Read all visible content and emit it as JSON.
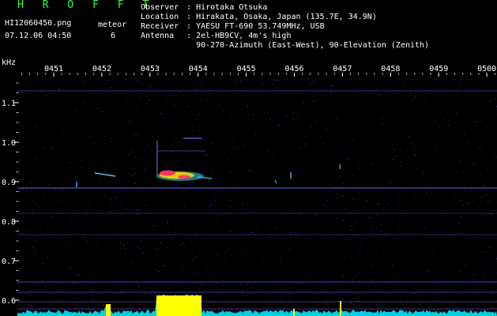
{
  "header": {
    "title": "H R O F F T",
    "file_name": "HI12060450.png",
    "meteor_label": "meteor",
    "timestamp": "07.12.06 04:50",
    "meteor_count": "6"
  },
  "info": [
    {
      "label": "Observer",
      "sep": ":",
      "value": "Hirotaka Otsuka"
    },
    {
      "label": "Location",
      "sep": ":",
      "value": "Hirakata, Osaka, Japan (135.7E, 34.9N)"
    },
    {
      "label": "Receiver",
      "sep": ":",
      "value": "YAESU FT-690 53.749MHz, USB"
    },
    {
      "label": "Antenna",
      "sep": ":",
      "value": "2el-HB9CV, 4m's high"
    },
    {
      "label": "",
      "sep": " ",
      "value": "90-270-Azimuth (East-West), 90-Elevation (Zenith)"
    }
  ],
  "axis": {
    "y_unit": "kHz",
    "time_ticks": [
      "0451",
      "0452",
      "0453",
      "0454",
      "0455",
      "0456",
      "0457",
      "0458",
      "0459",
      "0500"
    ],
    "freq_ticks": [
      "1.1",
      "1.0",
      "0.9",
      "0.8",
      "0.7",
      "0.6"
    ]
  },
  "colors": {
    "background": "#000000",
    "header_green": "#33ff33",
    "text_white": "#ffffff",
    "noise_blue": "#2a2a9a",
    "carrier_line": "#5a5ae0",
    "echo_hot": "#ff3060",
    "echo_warm": "#ffd000",
    "echo_cyan": "#30e0ff",
    "level_cyan": "#00e5ff",
    "level_peak": "#ffff00"
  }
}
